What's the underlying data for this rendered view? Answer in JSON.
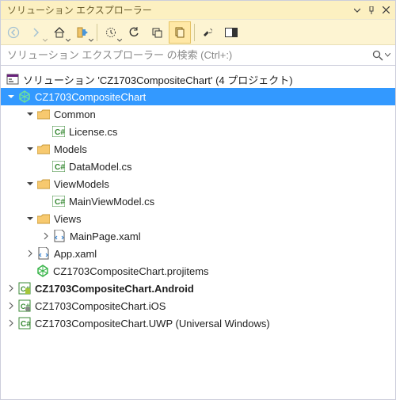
{
  "window": {
    "title": "ソリューション エクスプローラー"
  },
  "search": {
    "placeholder": "ソリューション エクスプローラー の検索 (Ctrl+:)"
  },
  "tree": {
    "solution": "ソリューション 'CZ1703CompositeChart' (4 プロジェクト)",
    "project": "CZ1703CompositeChart",
    "common_folder": "Common",
    "common_file1": "License.cs",
    "models_folder": "Models",
    "models_file1": "DataModel.cs",
    "viewmodels_folder": "ViewModels",
    "viewmodels_file1": "MainViewModel.cs",
    "views_folder": "Views",
    "views_file1": "MainPage.xaml",
    "appxaml": "App.xaml",
    "projitems": "CZ1703CompositeChart.projitems",
    "android": "CZ1703CompositeChart.Android",
    "ios": "CZ1703CompositeChart.iOS",
    "uwp": "CZ1703CompositeChart.UWP (Universal Windows)"
  }
}
